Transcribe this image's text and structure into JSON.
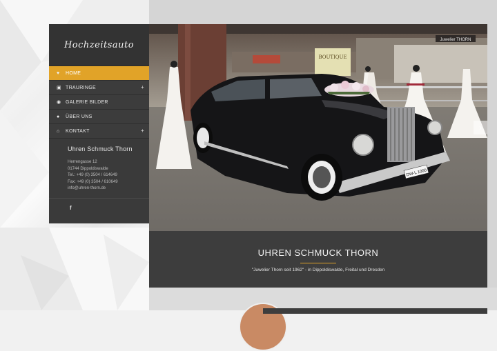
{
  "logo": {
    "text": "Hochzeitsauto"
  },
  "nav": {
    "items": [
      {
        "label": "Home",
        "icon": "heart-icon",
        "glyph": "♥",
        "active": true,
        "has_submenu": false
      },
      {
        "label": "Trauringe",
        "icon": "gift-icon",
        "glyph": "▣",
        "active": false,
        "has_submenu": true
      },
      {
        "label": "Galerie Bilder",
        "icon": "camera-icon",
        "glyph": "◉",
        "active": false,
        "has_submenu": false
      },
      {
        "label": "Über uns",
        "icon": "user-icon",
        "glyph": "●",
        "active": false,
        "has_submenu": false
      },
      {
        "label": "Kontakt",
        "icon": "home-icon",
        "glyph": "⌂",
        "active": false,
        "has_submenu": true
      }
    ],
    "plus": "+"
  },
  "contact": {
    "company": "Uhren Schmuck Thorn",
    "street": "Herrengasse 12",
    "city": "01744 Dippoldiswalde",
    "phone": "Tel.: +49 (0) 3504 / 614649",
    "fax": "Fax: +49 (0) 3504 / 610649",
    "email": "info@uhren-thorn.de"
  },
  "social": {
    "facebook": "f"
  },
  "hero": {
    "boutique_sign": "BOUTIQUE",
    "store_sign": "Juwelier THORN",
    "plate": "DW-L 1000",
    "next_arrow": "›"
  },
  "caption": {
    "title": "UHREN SCHMUCK THORN",
    "subtitle": "\"Juwelier Thorn seit 1962\" - in Dippoldiswalde, Freital und Dresden"
  },
  "colors": {
    "accent": "#e1a328",
    "sidebar": "#3a3a3a",
    "caption": "#3d3d3d"
  }
}
